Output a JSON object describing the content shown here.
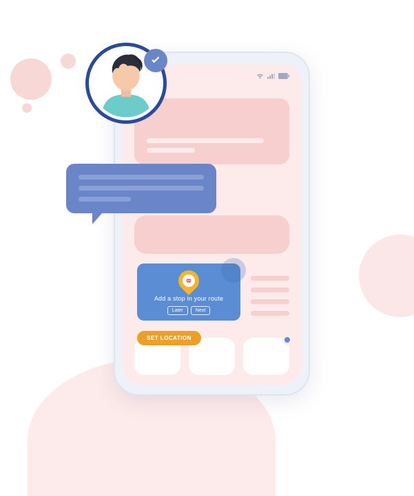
{
  "tooltip": {
    "title": "Add a stop in your route",
    "later_label": "Later",
    "next_label": "Next"
  },
  "cta": {
    "set_location_label": "SET LOCATION"
  }
}
